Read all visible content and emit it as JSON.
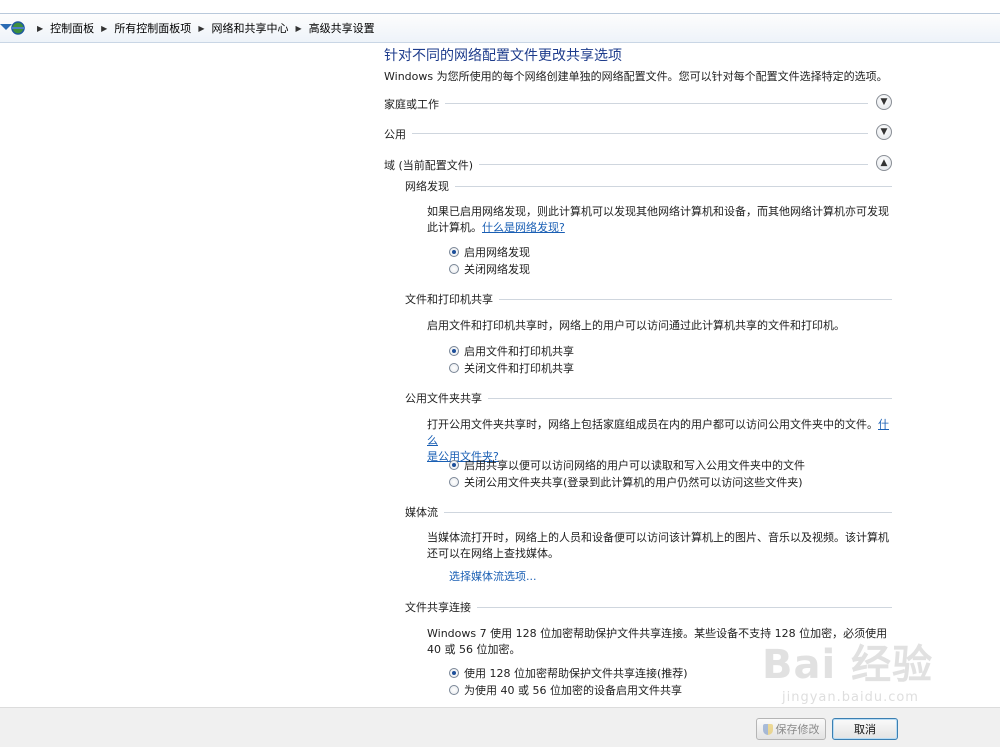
{
  "breadcrumb": {
    "items": [
      "控制面板",
      "所有控制面板项",
      "网络和共享中心",
      "高级共享设置"
    ]
  },
  "page": {
    "title": "针对不同的网络配置文件更改共享选项",
    "description": "Windows 为您所使用的每个网络创建单独的网络配置文件。您可以针对每个配置文件选择特定的选项。"
  },
  "profiles": {
    "home": {
      "label": "家庭或工作"
    },
    "public": {
      "label": "公用"
    },
    "domain": {
      "label": "域 (当前配置文件)"
    }
  },
  "network_discovery": {
    "heading": "网络发现",
    "description": "如果已启用网络发现，则此计算机可以发现其他网络计算机和设备，而其他网络计算机亦可发现此计算机。",
    "link": "什么是网络发现?",
    "options": [
      {
        "label": "启用网络发现",
        "selected": true
      },
      {
        "label": "关闭网络发现",
        "selected": false
      }
    ]
  },
  "file_printer_sharing": {
    "heading": "文件和打印机共享",
    "description": "启用文件和打印机共享时，网络上的用户可以访问通过此计算机共享的文件和打印机。",
    "options": [
      {
        "label": "启用文件和打印机共享",
        "selected": true
      },
      {
        "label": "关闭文件和打印机共享",
        "selected": false
      }
    ]
  },
  "public_folder_sharing": {
    "heading": "公用文件夹共享",
    "description": "打开公用文件夹共享时，网络上包括家庭组成员在内的用户都可以访问公用文件夹中的文件。",
    "link_part1": "什么",
    "link_part2": "是公用文件夹?",
    "options": [
      {
        "label": "启用共享以便可以访问网络的用户可以读取和写入公用文件夹中的文件",
        "selected": true
      },
      {
        "label": "关闭公用文件夹共享(登录到此计算机的用户仍然可以访问这些文件夹)",
        "selected": false
      }
    ]
  },
  "media_streaming": {
    "heading": "媒体流",
    "description": "当媒体流打开时，网络上的人员和设备便可以访问该计算机上的图片、音乐以及视频。该计算机还可以在网络上查找媒体。",
    "link": "选择媒体流选项..."
  },
  "file_sharing_connections": {
    "heading": "文件共享连接",
    "description": "Windows 7 使用 128 位加密帮助保护文件共享连接。某些设备不支持 128 位加密，必须使用 40 或 56 位加密。",
    "options": [
      {
        "label": "使用 128 位加密帮助保护文件共享连接(推荐)",
        "selected": true
      },
      {
        "label": "为使用 40 或 56 位加密的设备启用文件共享",
        "selected": false
      }
    ]
  },
  "footer": {
    "save_label": "保存修改",
    "cancel_label": "取消"
  },
  "watermark": {
    "main": "Bai 经验",
    "sub": "jingyan.baidu.com"
  },
  "icons": {
    "address_icon": "network-icon",
    "chevron": "chevron-icon",
    "shield": "uac-shield-icon"
  },
  "colors": {
    "title": "#1e3c8c",
    "link": "#1a5fb4",
    "accent_radio": "#1d4f9a"
  }
}
